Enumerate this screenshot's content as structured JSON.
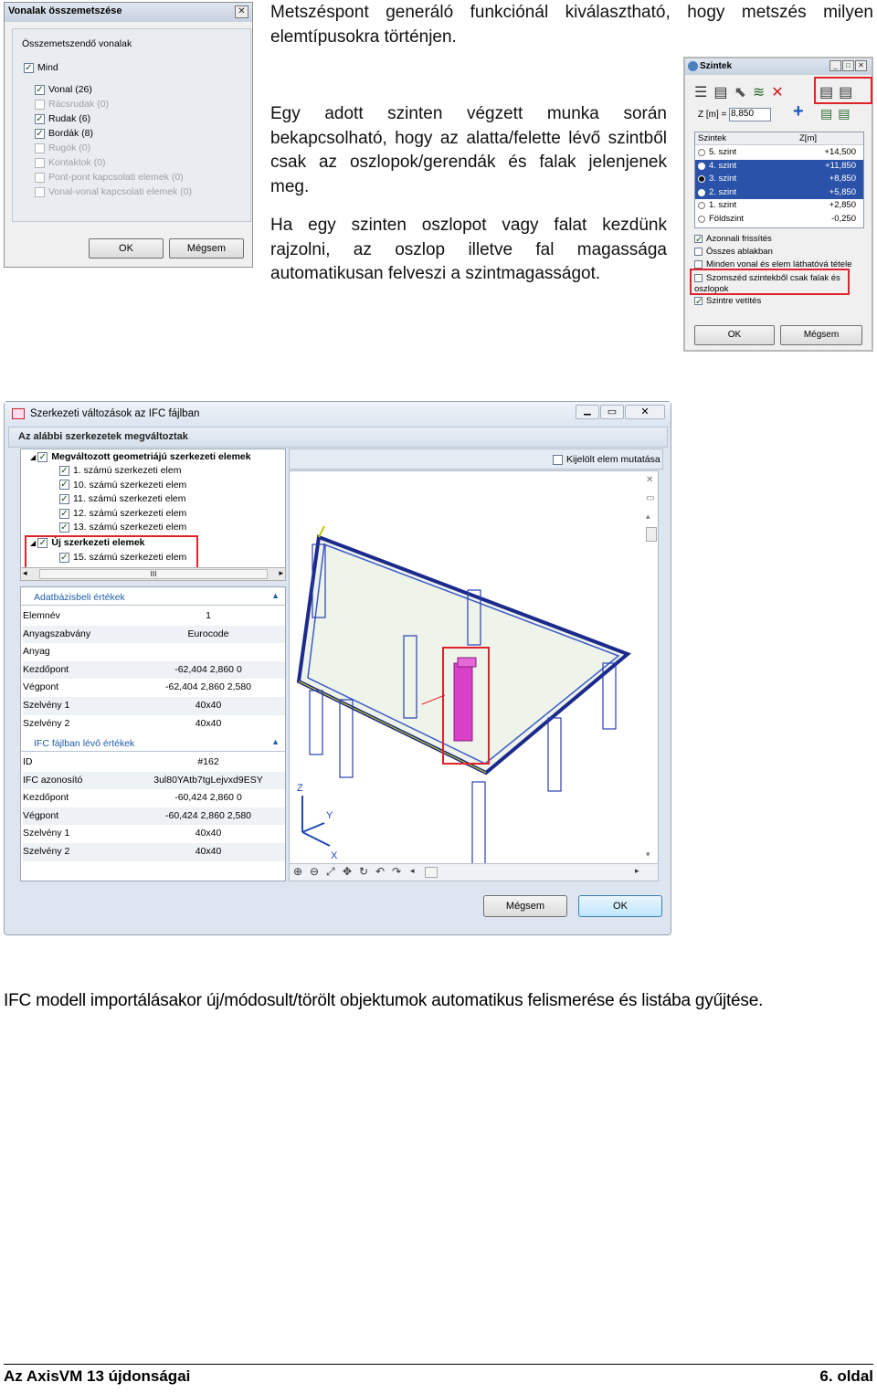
{
  "text": {
    "para1": "Metszéspont generáló funkciónál kiválasztható, hogy metszés milyen elemtípusokra történjen.",
    "para2": "Egy adott szinten végzett munka során bekapcsolható, hogy az alatta/felette lévő szintből csak az oszlopok/gerendák és falak jelenjenek meg.",
    "para3": "Ha egy szinten oszlopot vagy falat kezdünk rajzolni, az oszlop illetve fal magassága automatikusan felveszi a szintmagasságot.",
    "caption": "IFC modell importálásakor új/módosult/törölt objektumok automatikus felismerése és listába gyűjtése."
  },
  "footer": {
    "left": "Az AxisVM 13 újdonságai",
    "right": "6. oldal"
  },
  "vonalak": {
    "title": "Vonalak összemetszése",
    "group": "Összemetszendő vonalak",
    "items": [
      {
        "label": "Mind",
        "checked": true,
        "enabled": true
      },
      {
        "label": "Vonal (26)",
        "checked": true,
        "enabled": true
      },
      {
        "label": "Rácsrudak (0)",
        "checked": false,
        "enabled": false
      },
      {
        "label": "Rudak (6)",
        "checked": true,
        "enabled": true
      },
      {
        "label": "Bordák (8)",
        "checked": true,
        "enabled": true
      },
      {
        "label": "Rugók (0)",
        "checked": false,
        "enabled": false
      },
      {
        "label": "Kontaktok (0)",
        "checked": false,
        "enabled": false
      },
      {
        "label": "Pont-pont kapcsolati elemek (0)",
        "checked": false,
        "enabled": false
      },
      {
        "label": "Vonal-vonal kapcsolati elemek (0)",
        "checked": false,
        "enabled": false
      }
    ],
    "ok": "OK",
    "cancel": "Mégsem"
  },
  "szintek": {
    "title": "Szintek",
    "z_label": "Z [m] =",
    "z_value": "8,850",
    "col_name": "Szintek",
    "col_z": "Z[m]",
    "rows": [
      {
        "name": "5. szint",
        "z": "+14,500",
        "sel": false,
        "hl": false
      },
      {
        "name": "4. szint",
        "z": "+11,850",
        "sel": false,
        "hl": true
      },
      {
        "name": "3. szint",
        "z": "+8,850",
        "sel": true,
        "hl": true
      },
      {
        "name": "2. szint",
        "z": "+5,850",
        "sel": false,
        "hl": true
      },
      {
        "name": "1. szint",
        "z": "+2,850",
        "sel": false,
        "hl": false
      },
      {
        "name": "Földszint",
        "z": "-0,250",
        "sel": false,
        "hl": false
      }
    ],
    "opt1": "Azonnali frissítés",
    "opt2": "Összes ablakban",
    "opt3": "Minden vonal és elem láthatóvá tétele",
    "opt4": "Szomszéd szintekből csak falak és oszlopok",
    "opt5": "Szintre vetítés",
    "ok": "OK",
    "cancel": "Mégsem"
  },
  "ifc": {
    "title": "Szerkezeti változások az IFC fájlban",
    "subtitle": "Az alábbi szerkezetek megváltoztak",
    "show_selected": "Kijelölt elem mutatása",
    "tree_group1": "Megváltozott geometriájú szerkezeti elemek",
    "tree_items1": [
      "1. számú szerkezeti elem",
      "10. számú szerkezeti elem",
      "11. számú szerkezeti elem",
      "12. számú szerkezeti elem",
      "13. számú szerkezeti elem"
    ],
    "tree_group2": "Új szerkezeti elemek",
    "tree_items2": [
      "15. számú szerkezeti elem"
    ],
    "db_header": "Adatbázisbeli értékek",
    "db_rows": [
      {
        "k": "Elemnév",
        "v": "1"
      },
      {
        "k": "Anyagszabvány",
        "v": "Eurocode"
      },
      {
        "k": "Anyag",
        "v": ""
      },
      {
        "k": "Kezdőpont",
        "v": "-62,404 2,860 0"
      },
      {
        "k": "Végpont",
        "v": "-62,404 2,860 2,580"
      },
      {
        "k": "Szelvény 1",
        "v": "40x40"
      },
      {
        "k": "Szelvény 2",
        "v": "40x40"
      }
    ],
    "file_header": "IFC fájlban lévő értékek",
    "file_rows": [
      {
        "k": "ID",
        "v": "#162"
      },
      {
        "k": "IFC azonosító",
        "v": "3ul80YAtb7tgLejvxd9ESY"
      },
      {
        "k": "Kezdőpont",
        "v": "-60,424 2,860 0"
      },
      {
        "k": "Végpont",
        "v": "-60,424 2,860 2,580"
      },
      {
        "k": "Szelvény 1",
        "v": "40x40"
      },
      {
        "k": "Szelvény 2",
        "v": "40x40"
      }
    ],
    "axis_z": "Z",
    "axis_y": "Y",
    "axis_x": "X",
    "scroll_thumb": "III",
    "cancel": "Mégsem",
    "ok": "OK"
  }
}
